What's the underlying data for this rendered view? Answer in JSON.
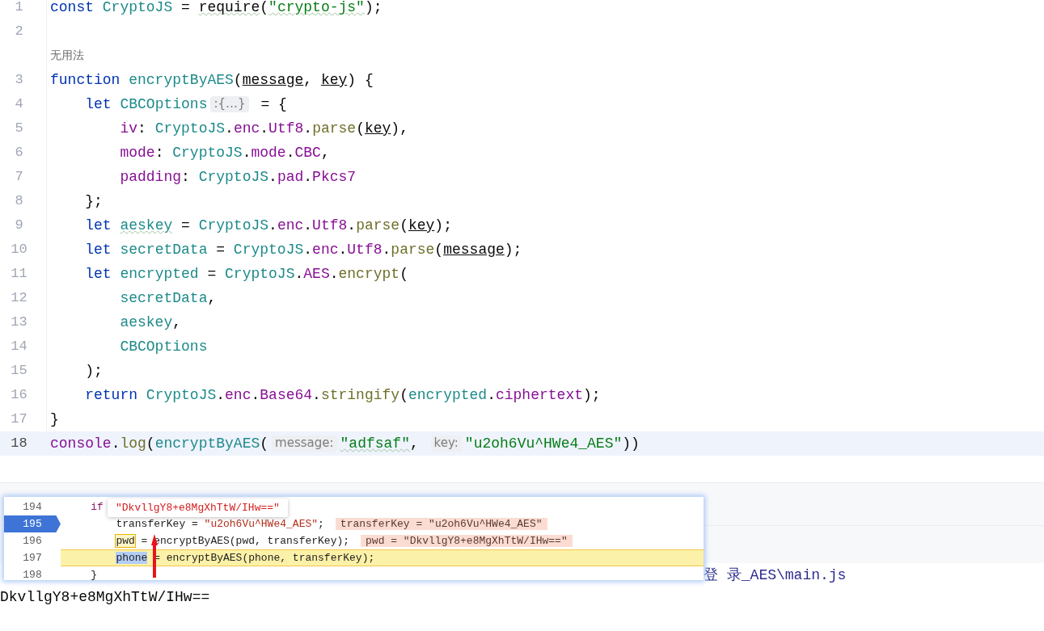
{
  "editor": {
    "lines": [
      {
        "kind": "code",
        "num": "1",
        "current": false,
        "tokens": [
          {
            "t": "const ",
            "kind": "kw"
          },
          {
            "t": "CryptoJS",
            "kind": "cls"
          },
          {
            "t": " = ",
            "kind": "plain"
          },
          {
            "t": "require",
            "kind": "plain",
            "warn": true
          },
          {
            "t": "(",
            "kind": "plain"
          },
          {
            "t": "\"crypto-js\"",
            "kind": "str",
            "warn": true
          },
          {
            "t": ");",
            "kind": "plain"
          }
        ]
      },
      {
        "kind": "code",
        "num": "2",
        "current": false
      },
      {
        "kind": "usage",
        "text": "无用法"
      },
      {
        "kind": "code",
        "num": "3",
        "current": false,
        "tokens": [
          {
            "t": "function ",
            "kind": "kw"
          },
          {
            "t": "encryptByAES",
            "kind": "cls"
          },
          {
            "t": "(",
            "kind": "plain"
          },
          {
            "t": "message",
            "kind": "param"
          },
          {
            "t": ", ",
            "kind": "plain"
          },
          {
            "t": "key",
            "kind": "param"
          },
          {
            "t": ") {",
            "kind": "plain"
          }
        ]
      },
      {
        "kind": "code",
        "num": "4",
        "current": false,
        "tokens": [
          {
            "t": "    let ",
            "kind": "kw"
          },
          {
            "t": "CBCOptions",
            "kind": "cls"
          },
          {
            "t": ":{…}",
            "kind": "hint"
          },
          {
            "t": " = {",
            "kind": "plain"
          }
        ]
      },
      {
        "kind": "code",
        "num": "5",
        "current": false,
        "tokens": [
          {
            "t": "        iv",
            "kind": "prop"
          },
          {
            "t": ": ",
            "kind": "plain"
          },
          {
            "t": "CryptoJS",
            "kind": "cls"
          },
          {
            "t": ".",
            "kind": "plain"
          },
          {
            "t": "enc",
            "kind": "prop"
          },
          {
            "t": ".",
            "kind": "plain"
          },
          {
            "t": "Utf8",
            "kind": "prop"
          },
          {
            "t": ".",
            "kind": "plain"
          },
          {
            "t": "parse",
            "kind": "fn"
          },
          {
            "t": "(",
            "kind": "plain"
          },
          {
            "t": "key",
            "kind": "param"
          },
          {
            "t": "),",
            "kind": "plain"
          }
        ]
      },
      {
        "kind": "code",
        "num": "6",
        "current": false,
        "tokens": [
          {
            "t": "        mode",
            "kind": "prop"
          },
          {
            "t": ": ",
            "kind": "plain"
          },
          {
            "t": "CryptoJS",
            "kind": "cls"
          },
          {
            "t": ".",
            "kind": "plain"
          },
          {
            "t": "mode",
            "kind": "prop"
          },
          {
            "t": ".",
            "kind": "plain"
          },
          {
            "t": "CBC",
            "kind": "prop"
          },
          {
            "t": ",",
            "kind": "plain"
          }
        ]
      },
      {
        "kind": "code",
        "num": "7",
        "current": false,
        "tokens": [
          {
            "t": "        padding",
            "kind": "prop"
          },
          {
            "t": ": ",
            "kind": "plain"
          },
          {
            "t": "CryptoJS",
            "kind": "cls"
          },
          {
            "t": ".",
            "kind": "plain"
          },
          {
            "t": "pad",
            "kind": "prop"
          },
          {
            "t": ".",
            "kind": "plain"
          },
          {
            "t": "Pkcs7",
            "kind": "prop"
          }
        ]
      },
      {
        "kind": "code",
        "num": "8",
        "current": false,
        "tokens": [
          {
            "t": "    };",
            "kind": "plain"
          }
        ]
      },
      {
        "kind": "code",
        "num": "9",
        "current": false,
        "tokens": [
          {
            "t": "    let ",
            "kind": "kw"
          },
          {
            "t": "aeskey",
            "kind": "cls",
            "warn": true
          },
          {
            "t": " = ",
            "kind": "plain"
          },
          {
            "t": "CryptoJS",
            "kind": "cls"
          },
          {
            "t": ".",
            "kind": "plain"
          },
          {
            "t": "enc",
            "kind": "prop"
          },
          {
            "t": ".",
            "kind": "plain"
          },
          {
            "t": "Utf8",
            "kind": "prop"
          },
          {
            "t": ".",
            "kind": "plain"
          },
          {
            "t": "parse",
            "kind": "fn"
          },
          {
            "t": "(",
            "kind": "plain"
          },
          {
            "t": "key",
            "kind": "param"
          },
          {
            "t": ");",
            "kind": "plain"
          }
        ]
      },
      {
        "kind": "code",
        "num": "10",
        "current": false,
        "tokens": [
          {
            "t": "    let ",
            "kind": "kw"
          },
          {
            "t": "secretData",
            "kind": "cls"
          },
          {
            "t": " = ",
            "kind": "plain"
          },
          {
            "t": "CryptoJS",
            "kind": "cls"
          },
          {
            "t": ".",
            "kind": "plain"
          },
          {
            "t": "enc",
            "kind": "prop"
          },
          {
            "t": ".",
            "kind": "plain"
          },
          {
            "t": "Utf8",
            "kind": "prop"
          },
          {
            "t": ".",
            "kind": "plain"
          },
          {
            "t": "parse",
            "kind": "fn"
          },
          {
            "t": "(",
            "kind": "plain"
          },
          {
            "t": "message",
            "kind": "param"
          },
          {
            "t": ");",
            "kind": "plain"
          }
        ]
      },
      {
        "kind": "code",
        "num": "11",
        "current": false,
        "tokens": [
          {
            "t": "    let ",
            "kind": "kw"
          },
          {
            "t": "encrypted",
            "kind": "cls"
          },
          {
            "t": " = ",
            "kind": "plain"
          },
          {
            "t": "CryptoJS",
            "kind": "cls"
          },
          {
            "t": ".",
            "kind": "plain"
          },
          {
            "t": "AES",
            "kind": "prop"
          },
          {
            "t": ".",
            "kind": "plain"
          },
          {
            "t": "encrypt",
            "kind": "fn"
          },
          {
            "t": "(",
            "kind": "plain"
          }
        ]
      },
      {
        "kind": "code",
        "num": "12",
        "current": false,
        "tokens": [
          {
            "t": "        secretData",
            "kind": "cls"
          },
          {
            "t": ",",
            "kind": "plain"
          }
        ]
      },
      {
        "kind": "code",
        "num": "13",
        "current": false,
        "tokens": [
          {
            "t": "        aeskey",
            "kind": "cls"
          },
          {
            "t": ",",
            "kind": "plain"
          }
        ]
      },
      {
        "kind": "code",
        "num": "14",
        "current": false,
        "tokens": [
          {
            "t": "        CBCOptions",
            "kind": "cls"
          }
        ]
      },
      {
        "kind": "code",
        "num": "15",
        "current": false,
        "tokens": [
          {
            "t": "    );",
            "kind": "plain"
          }
        ]
      },
      {
        "kind": "code",
        "num": "16",
        "current": false,
        "tokens": [
          {
            "t": "    return ",
            "kind": "kw"
          },
          {
            "t": "CryptoJS",
            "kind": "cls"
          },
          {
            "t": ".",
            "kind": "plain"
          },
          {
            "t": "enc",
            "kind": "prop"
          },
          {
            "t": ".",
            "kind": "plain"
          },
          {
            "t": "Base64",
            "kind": "prop"
          },
          {
            "t": ".",
            "kind": "plain"
          },
          {
            "t": "stringify",
            "kind": "fn"
          },
          {
            "t": "(",
            "kind": "plain"
          },
          {
            "t": "encrypted",
            "kind": "cls"
          },
          {
            "t": ".",
            "kind": "plain"
          },
          {
            "t": "ciphertext",
            "kind": "prop"
          },
          {
            "t": ");",
            "kind": "plain"
          }
        ]
      },
      {
        "kind": "code",
        "num": "17",
        "current": false,
        "tokens": [
          {
            "t": "}",
            "kind": "plain"
          }
        ]
      },
      {
        "kind": "code",
        "num": "18",
        "current": true,
        "tokens": [
          {
            "t": "console",
            "kind": "prop"
          },
          {
            "t": ".",
            "kind": "plain"
          },
          {
            "t": "log",
            "kind": "fn"
          },
          {
            "t": "(",
            "kind": "plain"
          },
          {
            "t": "encryptByAES",
            "kind": "cls"
          },
          {
            "t": "(",
            "kind": "plain"
          },
          {
            "t": "message:",
            "kind": "hint"
          },
          {
            "t": "\"adfsaf\"",
            "kind": "str",
            "warn": true
          },
          {
            "t": ", ",
            "kind": "plain"
          },
          {
            "t": "key:",
            "kind": "hint"
          },
          {
            "t": "\"u2oh6Vu^HWe4_AES\"",
            "kind": "str"
          },
          {
            "t": "))",
            "kind": "plain"
          }
        ]
      }
    ]
  },
  "debugger_popup": {
    "tooltip": "\"DkvllgY8+e8MgXhTtW/IHw==\"",
    "lines": [
      {
        "num": "194",
        "breakpoint": false,
        "current": false,
        "tokens": [
          {
            "t": "if",
            "kind": "kw"
          }
        ],
        "children": [
          {
            "num": "195",
            "breakpoint": true,
            "current": false,
            "tokens": [
              {
                "t": "transferKey = ",
                "kind": "plain"
              },
              {
                "t": "\"u2oh6Vu^HWe4_AES\"",
                "kind": "str"
              },
              {
                "t": ";",
                "kind": "plain"
              }
            ],
            "value": "transferKey = \"u2oh6Vu^HWe4_AES\""
          },
          {
            "num": "196",
            "breakpoint": false,
            "current": false,
            "tokens": [
              {
                "t": "pwd",
                "kind": "found"
              },
              {
                "t": " = encryptByAES(pwd, transferKey);",
                "kind": "plain"
              }
            ],
            "value": "pwd = \"DkvllgY8+e8MgXhTtW/IHw==\""
          },
          {
            "num": "197",
            "breakpoint": false,
            "current": true,
            "tokens": [
              {
                "t": "phone",
                "kind": "picked"
              },
              {
                "t": " = encryptByAES(phone, transferKey);",
                "kind": "plain"
              }
            ]
          }
        ]
      },
      {
        "num": "198",
        "breakpoint": false,
        "current": false,
        "tokens": [
          {
            "t": "}",
            "kind": "plain"
          }
        ]
      }
    ]
  },
  "console": {
    "path": "登 录_AES\\main.js",
    "output": "DkvllgY8+e8MgXhTtW/IHw=="
  }
}
